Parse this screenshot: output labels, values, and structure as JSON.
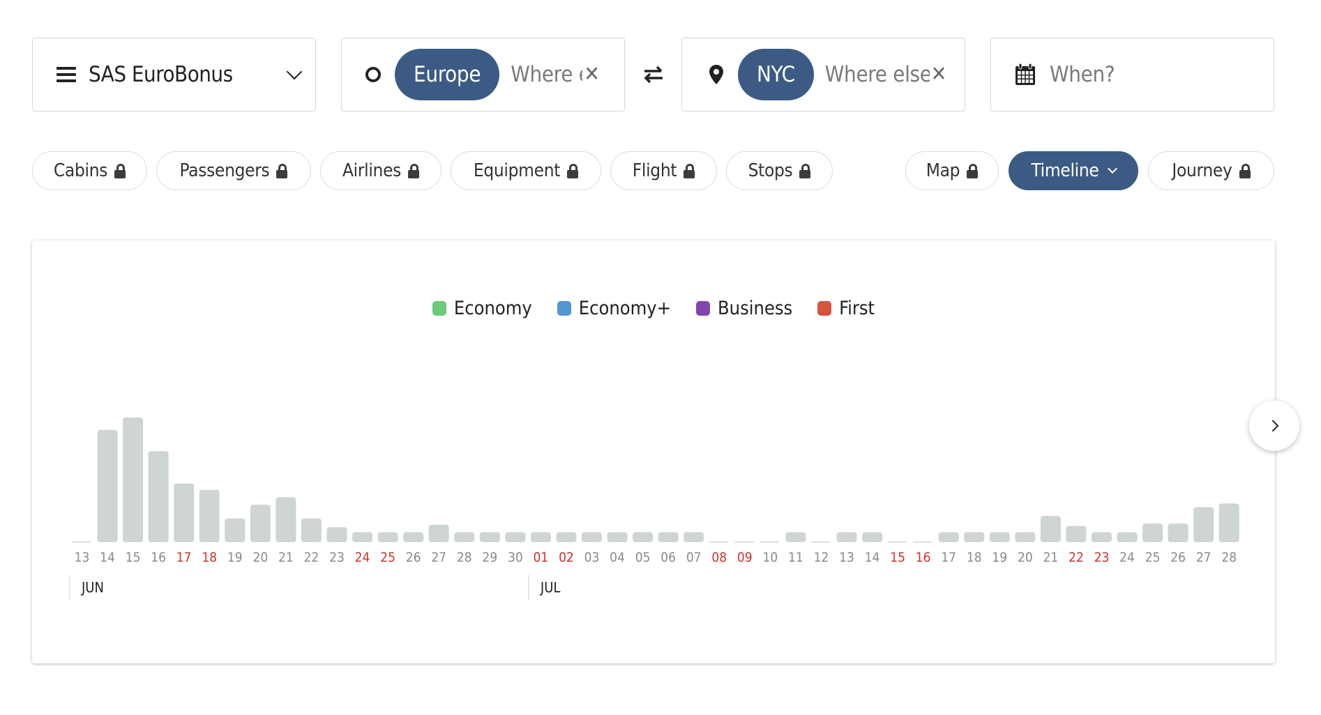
{
  "program": {
    "label": "SAS EuroBonus"
  },
  "origin": {
    "chip": "Europe",
    "placeholder": "Where else?"
  },
  "destination": {
    "chip": "NYC",
    "placeholder": "Where else?"
  },
  "when": {
    "placeholder": "When?"
  },
  "filters": [
    {
      "label": "Cabins",
      "locked": true
    },
    {
      "label": "Passengers",
      "locked": true
    },
    {
      "label": "Airlines",
      "locked": true
    },
    {
      "label": "Equipment",
      "locked": true
    },
    {
      "label": "Flight",
      "locked": true
    },
    {
      "label": "Stops",
      "locked": true
    }
  ],
  "views": [
    {
      "label": "Map",
      "locked": true,
      "active": false
    },
    {
      "label": "Timeline",
      "locked": false,
      "active": true
    },
    {
      "label": "Journey",
      "locked": true,
      "active": false
    }
  ],
  "colors": {
    "accent": "#3b5b84",
    "bar": "#ced5d4",
    "weekend": "#d0312d",
    "tick": "#8a8a8a"
  },
  "chart_data": {
    "type": "bar",
    "title": "",
    "legend": [
      {
        "name": "Economy",
        "color": "#6acb7c"
      },
      {
        "name": "Economy+",
        "color": "#5296d5"
      },
      {
        "name": "Business",
        "color": "#8345ad"
      },
      {
        "name": "First",
        "color": "#d6553f"
      }
    ],
    "legend_position": "top-center",
    "months": [
      {
        "label": "JUN",
        "start_index": 0
      },
      {
        "label": "JUL",
        "start_index": 18
      }
    ],
    "categories": [
      "13",
      "14",
      "15",
      "16",
      "17",
      "18",
      "19",
      "20",
      "21",
      "22",
      "23",
      "24",
      "25",
      "26",
      "27",
      "28",
      "29",
      "30",
      "01",
      "02",
      "03",
      "04",
      "05",
      "06",
      "07",
      "08",
      "09",
      "10",
      "11",
      "12",
      "13",
      "14",
      "15",
      "16",
      "17",
      "18",
      "19",
      "20",
      "21",
      "22",
      "23",
      "24",
      "25",
      "26",
      "27",
      "28"
    ],
    "weekend": [
      false,
      false,
      false,
      false,
      true,
      true,
      false,
      false,
      false,
      false,
      false,
      true,
      true,
      false,
      false,
      false,
      false,
      false,
      true,
      true,
      false,
      false,
      false,
      false,
      false,
      true,
      true,
      false,
      false,
      false,
      false,
      false,
      true,
      true,
      false,
      false,
      false,
      false,
      false,
      true,
      true,
      false,
      false,
      false,
      false,
      false
    ],
    "values": [
      0,
      90,
      100,
      73,
      47,
      42,
      19,
      30,
      36,
      19,
      12,
      8,
      8,
      8,
      14,
      8,
      8,
      8,
      8,
      8,
      8,
      8,
      8,
      8,
      8,
      0,
      0,
      0,
      8,
      0,
      8,
      8,
      0,
      0,
      8,
      8,
      8,
      8,
      21,
      13,
      8,
      8,
      15,
      15,
      28,
      31
    ],
    "ylim": [
      0,
      100
    ],
    "xlabel": "",
    "ylabel": "",
    "grid": false
  }
}
